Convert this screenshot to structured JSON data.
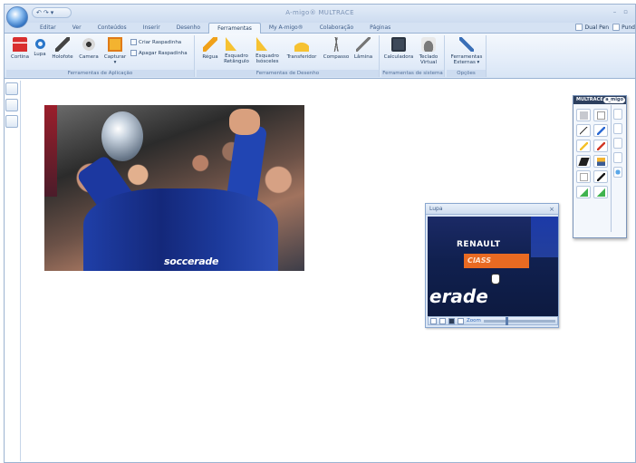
{
  "window": {
    "title": "A-migo® MULTRACE",
    "controls": [
      "–",
      "▫"
    ]
  },
  "quick_access": {
    "items": [
      "↶",
      "↷",
      "▾"
    ]
  },
  "tabs": [
    {
      "label": "Editar"
    },
    {
      "label": "Ver"
    },
    {
      "label": "Conteúdos"
    },
    {
      "label": "Inserir"
    },
    {
      "label": "Desenho"
    },
    {
      "label": "Ferramentas",
      "active": true
    },
    {
      "label": "My A-migo®"
    },
    {
      "label": "Colaboração"
    },
    {
      "label": "Páginas"
    }
  ],
  "right_links": [
    {
      "label": "Dual Pen"
    },
    {
      "label": "Pund"
    }
  ],
  "ribbon": {
    "groups": [
      {
        "caption": "Ferramentas de Aplicação",
        "buttons": [
          {
            "label": "Cortina",
            "icon": "curtain-icon"
          },
          {
            "label": "Lupa",
            "icon": "magnifier-icon"
          },
          {
            "label": "Holofote",
            "icon": "spotlight-icon"
          },
          {
            "label": "Camera",
            "icon": "camera-icon"
          },
          {
            "label": "Capturar",
            "icon": "capture-icon",
            "sub": "▾"
          }
        ],
        "small_buttons": [
          {
            "label": "Criar Raspadinha",
            "icon": "create-scratch-icon"
          },
          {
            "label": "Apagar Raspadinha",
            "icon": "erase-scratch-icon"
          }
        ]
      },
      {
        "caption": "Ferramentas de Desenho",
        "buttons": [
          {
            "label": "Régua",
            "icon": "ruler-icon"
          },
          {
            "label": "Esquadro",
            "label2": "Retângulo",
            "icon": "set-square-right-icon"
          },
          {
            "label": "Esquadro",
            "label2": "Isósceles",
            "icon": "set-square-isosceles-icon"
          },
          {
            "label": "Transferidor",
            "icon": "protractor-icon"
          },
          {
            "label": "Compasso",
            "icon": "compass-icon"
          },
          {
            "label": "Lâmina",
            "icon": "blade-icon"
          }
        ]
      },
      {
        "caption": "Ferramentas de sistema",
        "buttons": [
          {
            "label": "Calculadora",
            "icon": "calculator-icon"
          },
          {
            "label": "Teclado",
            "label2": "Virtual",
            "icon": "keyboard-icon"
          }
        ]
      },
      {
        "caption": "Opções",
        "buttons": [
          {
            "label": "Ferramentas",
            "label2": "Externas ▾",
            "icon": "tools-icon"
          }
        ]
      }
    ]
  },
  "photo": {
    "sponsor_text": "soccerade"
  },
  "lupa_window": {
    "title": "Lupa",
    "close": "×",
    "view_text": {
      "brand": "RENAULT",
      "stripe": "ClASS",
      "big": "erade"
    },
    "zoom_label": "Zoom"
  },
  "palette": {
    "title": "MULTRACE",
    "logo": "a_migo"
  }
}
